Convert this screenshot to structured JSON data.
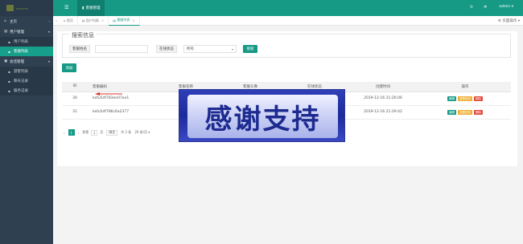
{
  "colors": {
    "accent": "#169a86",
    "sidebar": "#2f4050",
    "danger": "#e24a3b",
    "warning": "#f0ad2e"
  },
  "sidebar": {
    "home": "主页",
    "group_user": "用户管理",
    "user_items": [
      "用户列表",
      "客服列表"
    ],
    "group_chat": "会话管理",
    "chat_items": [
      "游客列表",
      "聊天记录",
      "服务记录"
    ]
  },
  "topbar": {
    "module": "客服管理",
    "user": "admin"
  },
  "tabs": {
    "home": "首页",
    "t1": "用户列表",
    "t2": "客服列表",
    "page_op": "页面操作"
  },
  "search": {
    "title": "搜索信息",
    "name_label": "客服姓名",
    "status_label": "在线状态",
    "status_value": "所有",
    "button": "搜索"
  },
  "add_button": "添加",
  "table": {
    "headers": [
      "ID",
      "客服编码",
      "客服名称",
      "客服头像",
      "在线状态",
      "创建时间",
      "操作"
    ],
    "rows": [
      {
        "id": "30",
        "code": "kefu5df783ee07ae1",
        "name": "客",
        "time": "2019-12-16 21:26:06"
      },
      {
        "id": "31",
        "code": "kefu5df786c6a2377",
        "name": "客",
        "time": "2019-12-16 21:29:42"
      }
    ],
    "ops": {
      "edit": "编辑",
      "reset": "重置密码",
      "del": "删除"
    }
  },
  "pager": {
    "prev": "‹",
    "current": "1",
    "next": "›",
    "goto_prefix": "到第",
    "goto_value": "1",
    "page_unit": "页",
    "confirm": "确定",
    "total": "共 2 条",
    "per_page": "20 条/页"
  },
  "overlay_text": "感谢支持"
}
